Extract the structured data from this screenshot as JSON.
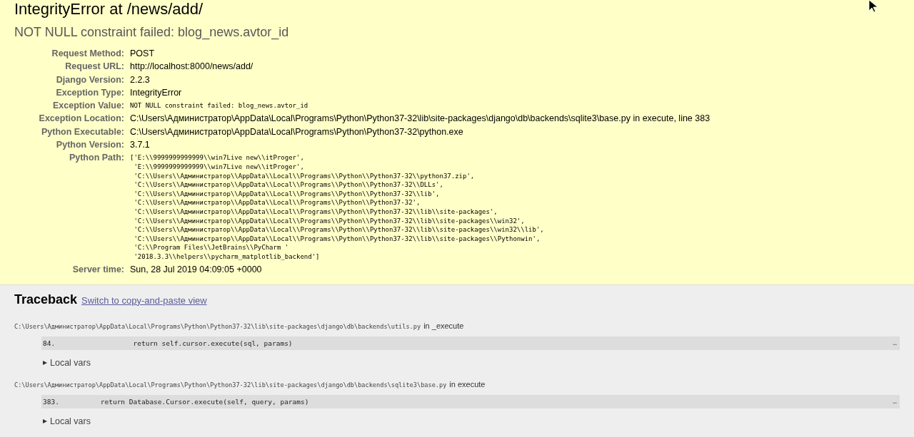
{
  "summary": {
    "title": "IntegrityError at /news/add/",
    "subtitle": "NOT NULL constraint failed: blog_news.avtor_id",
    "meta": [
      {
        "label": "Request Method:",
        "value": "POST",
        "kind": "text"
      },
      {
        "label": "Request URL:",
        "value": "http://localhost:8000/news/add/",
        "kind": "text"
      },
      {
        "label": "Django Version:",
        "value": "2.2.3",
        "kind": "text"
      },
      {
        "label": "Exception Type:",
        "value": "IntegrityError",
        "kind": "text"
      },
      {
        "label": "Exception Value:",
        "value": "NOT NULL constraint failed: blog_news.avtor_id",
        "kind": "code"
      },
      {
        "label": "Exception Location:",
        "value": "C:\\Users\\Администратор\\AppData\\Local\\Programs\\Python\\Python37-32\\lib\\site-packages\\django\\db\\backends\\sqlite3\\base.py in execute, line 383",
        "kind": "text"
      },
      {
        "label": "Python Executable:",
        "value": "C:\\Users\\Администратор\\AppData\\Local\\Programs\\Python\\Python37-32\\python.exe",
        "kind": "text"
      },
      {
        "label": "Python Version:",
        "value": "3.7.1",
        "kind": "text"
      },
      {
        "label": "Python Path:",
        "kind": "path",
        "lines": [
          "['E:\\\\9999999999999\\\\win7Live new\\\\itProger',",
          " 'E:\\\\9999999999999\\\\win7Live new\\\\itProger',",
          " 'C:\\\\Users\\\\Администратор\\\\AppData\\\\Local\\\\Programs\\\\Python\\\\Python37-32\\\\python37.zip',",
          " 'C:\\\\Users\\\\Администратор\\\\AppData\\\\Local\\\\Programs\\\\Python\\\\Python37-32\\\\DLLs',",
          " 'C:\\\\Users\\\\Администратор\\\\AppData\\\\Local\\\\Programs\\\\Python\\\\Python37-32\\\\lib',",
          " 'C:\\\\Users\\\\Администратор\\\\AppData\\\\Local\\\\Programs\\\\Python\\\\Python37-32',",
          " 'C:\\\\Users\\\\Администратор\\\\AppData\\\\Local\\\\Programs\\\\Python\\\\Python37-32\\\\lib\\\\site-packages',",
          " 'C:\\\\Users\\\\Администратор\\\\AppData\\\\Local\\\\Programs\\\\Python\\\\Python37-32\\\\lib\\\\site-packages\\\\win32',",
          " 'C:\\\\Users\\\\Администратор\\\\AppData\\\\Local\\\\Programs\\\\Python\\\\Python37-32\\\\lib\\\\site-packages\\\\win32\\\\lib',",
          " 'C:\\\\Users\\\\Администратор\\\\AppData\\\\Local\\\\Programs\\\\Python\\\\Python37-32\\\\lib\\\\site-packages\\\\Pythonwin',",
          " 'C:\\\\Program Files\\\\JetBrains\\\\PyCharm '",
          " '2018.3.3\\\\helpers\\\\pycharm_matplotlib_backend']"
        ]
      },
      {
        "label": "Server time:",
        "value": "Sun, 28 Jul 2019 04:09:05 +0000",
        "kind": "text"
      }
    ]
  },
  "traceback": {
    "title": "Traceback",
    "link": "Switch to copy-and-paste view",
    "frames": [
      {
        "file": "C:\\Users\\Администратор\\AppData\\Local\\Programs\\Python\\Python37-32\\lib\\site-packages\\django\\db\\backends\\utils.py",
        "location": "in _execute",
        "line_number": "84.",
        "code": "                return self.cursor.execute(sql, params)",
        "more": "…",
        "vars_label": "Local vars",
        "expanded": false
      },
      {
        "file": "C:\\Users\\Администратор\\AppData\\Local\\Programs\\Python\\Python37-32\\lib\\site-packages\\django\\db\\backends\\sqlite3\\base.py",
        "location": "in execute",
        "line_number": "383.",
        "code": "        return Database.Cursor.execute(self, query, params)",
        "more": "…",
        "vars_label": "Local vars",
        "expanded": false
      }
    ]
  }
}
